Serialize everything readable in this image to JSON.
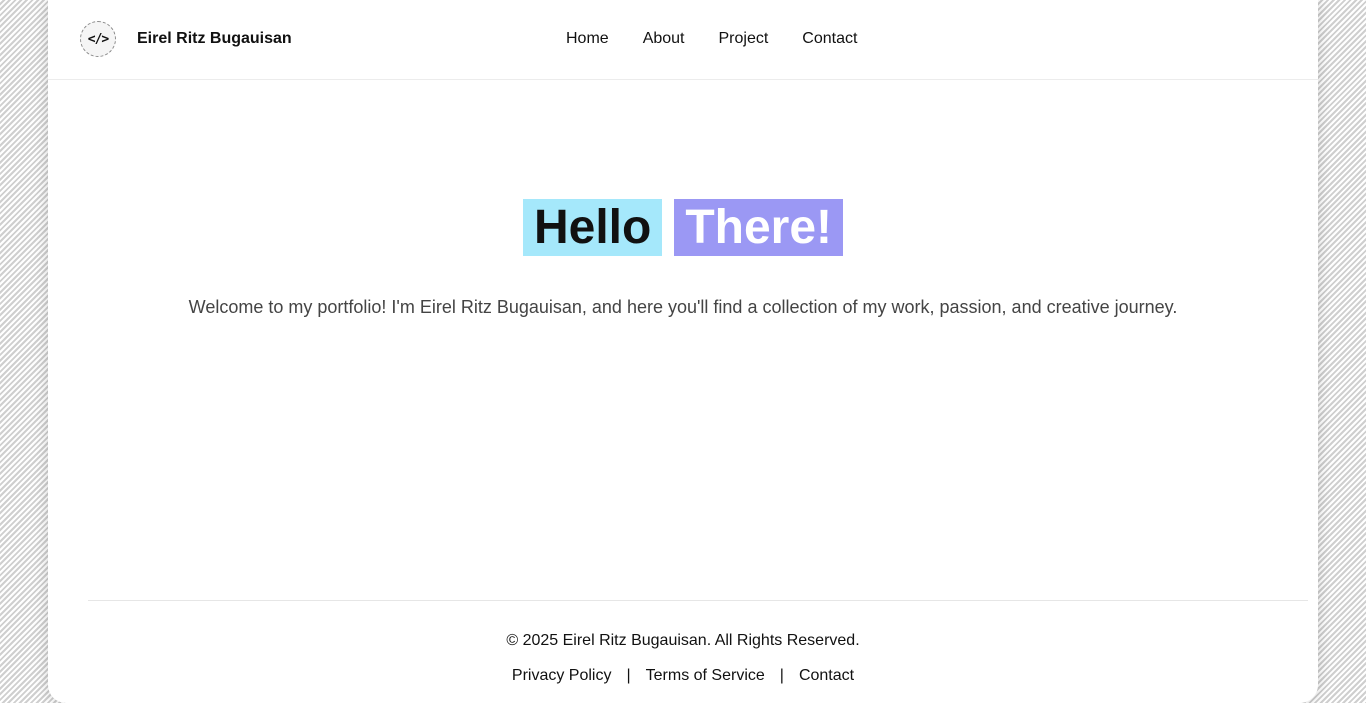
{
  "header": {
    "logo_text": "</>",
    "brand_name": "Eirel Ritz Bugauisan",
    "nav": [
      "Home",
      "About",
      "Project",
      "Contact"
    ]
  },
  "hero": {
    "word1": "Hello",
    "word2": "There!",
    "subtitle": "Welcome to my portfolio! I'm Eirel Ritz Bugauisan, and here you'll find a collection of my work, passion, and creative journey."
  },
  "footer": {
    "copyright": "© 2025 Eirel Ritz Bugauisan. All Rights Reserved.",
    "links": [
      "Privacy Policy",
      "Terms of Service",
      "Contact"
    ],
    "separator": "|"
  },
  "colors": {
    "hello_bg": "#a5e8fb",
    "there_bg": "#9b98f4"
  }
}
